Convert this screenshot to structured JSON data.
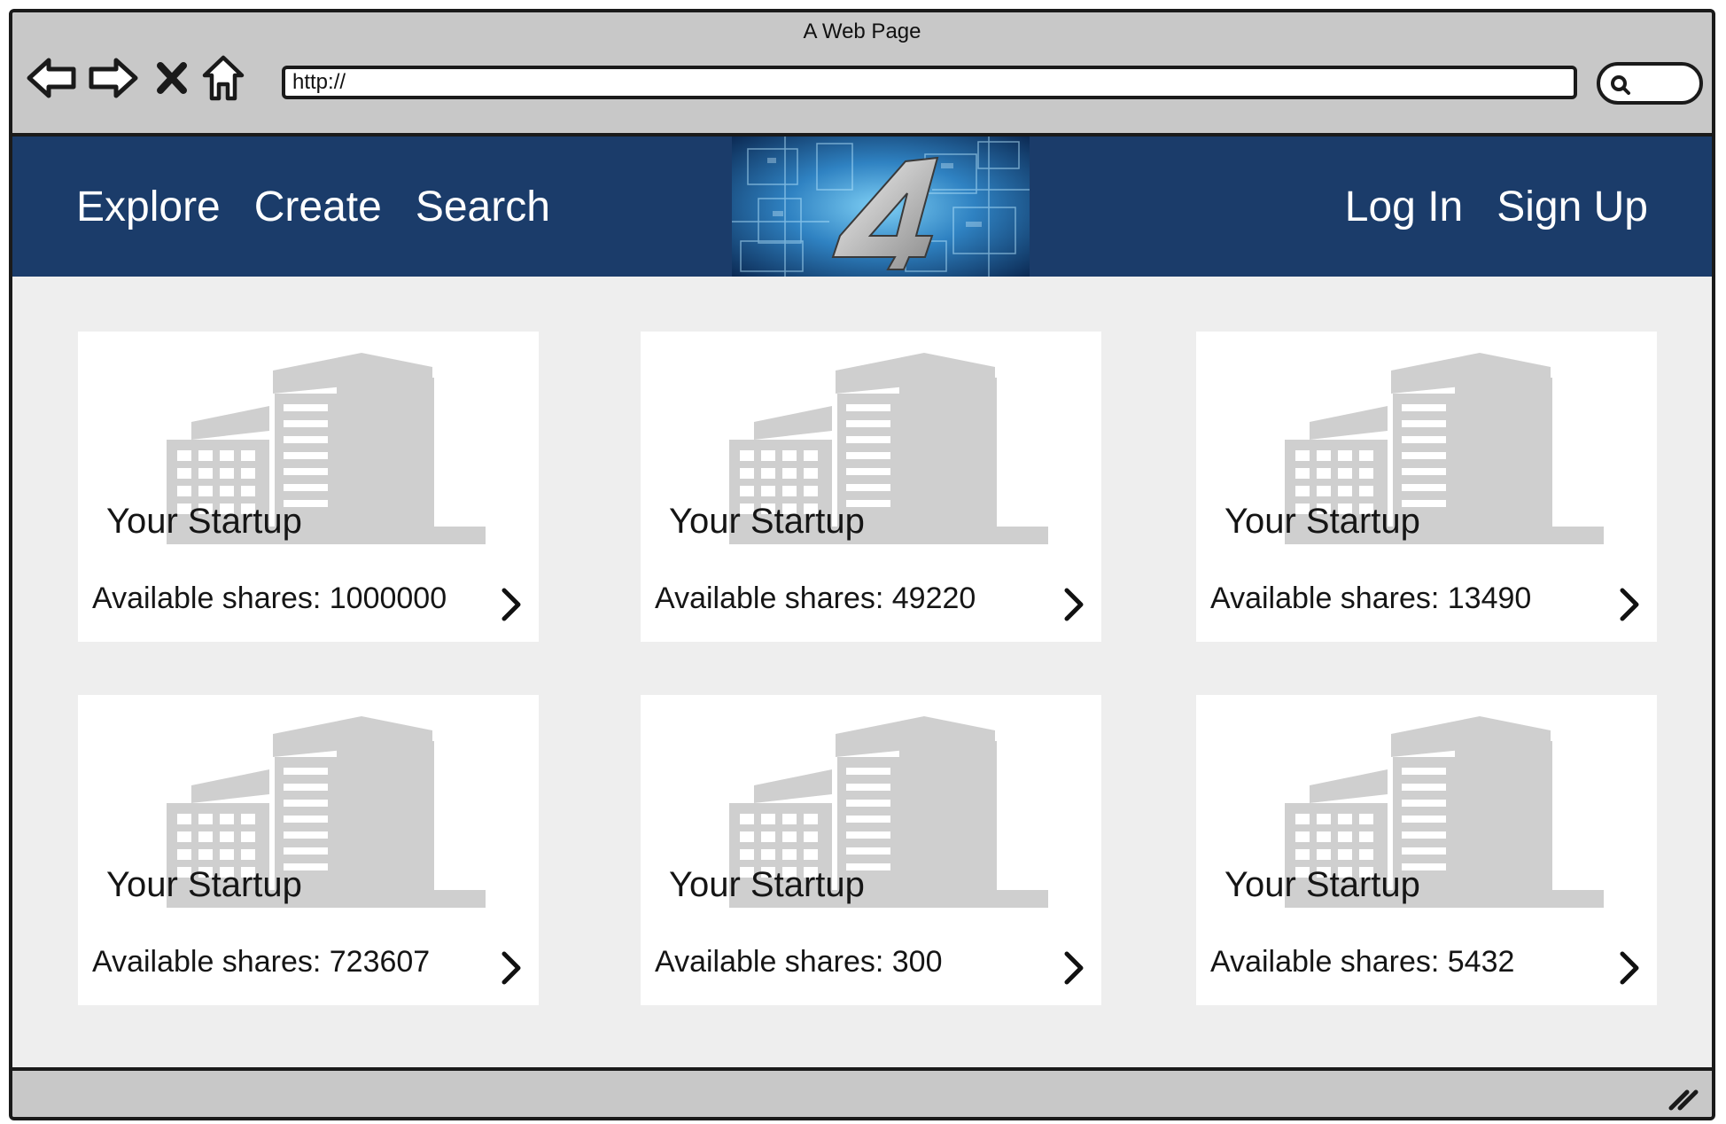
{
  "browser": {
    "window_title": "A Web Page",
    "url": "http://",
    "icons": {
      "back": "back-arrow-icon",
      "forward": "forward-arrow-icon",
      "stop": "close-x-icon",
      "home": "home-icon",
      "search": "search-icon"
    }
  },
  "header": {
    "background_color": "#1b3c6a",
    "nav_left": [
      "Explore",
      "Create",
      "Search"
    ],
    "nav_right": [
      "Log In",
      "Sign Up"
    ]
  },
  "cards": [
    {
      "title": "Your Startup",
      "shares": "Available shares: 1000000"
    },
    {
      "title": "Your Startup",
      "shares": "Available shares: 49220"
    },
    {
      "title": "Your Startup",
      "shares": "Available shares: 13490"
    },
    {
      "title": "Your Startup",
      "shares": "Available shares: 723607"
    },
    {
      "title": "Your Startup",
      "shares": "Available shares: 300"
    },
    {
      "title": "Your Startup",
      "shares": "Available shares: 5432"
    }
  ]
}
